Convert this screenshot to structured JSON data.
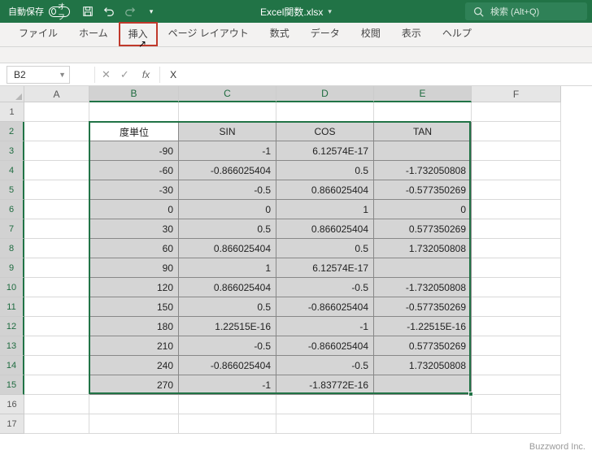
{
  "titlebar": {
    "autosave_label": "自動保存",
    "autosave_state": "オフ",
    "doc_name": "Excel関数.xlsx",
    "search_placeholder": "検索 (Alt+Q)"
  },
  "ribbon": {
    "tabs": [
      "ファイル",
      "ホーム",
      "挿入",
      "ページ レイアウト",
      "数式",
      "データ",
      "校閲",
      "表示",
      "ヘルプ"
    ],
    "highlighted_index": 2
  },
  "formula_bar": {
    "name_box": "B2",
    "formula_value": "X"
  },
  "grid": {
    "columns": [
      "A",
      "B",
      "C",
      "D",
      "E",
      "F"
    ],
    "selected_cols": [
      "B",
      "C",
      "D",
      "E"
    ],
    "row_start": 1,
    "row_end": 17,
    "selected_rows_start": 2,
    "selected_rows_end": 15,
    "headers": {
      "B": "度単位",
      "C": "SIN",
      "D": "COS",
      "E": "TAN"
    },
    "data": [
      {
        "B": "-90",
        "C": "-1",
        "D": "6.12574E-17",
        "E": ""
      },
      {
        "B": "-60",
        "C": "-0.866025404",
        "D": "0.5",
        "E": "-1.732050808"
      },
      {
        "B": "-30",
        "C": "-0.5",
        "D": "0.866025404",
        "E": "-0.577350269"
      },
      {
        "B": "0",
        "C": "0",
        "D": "1",
        "E": "0"
      },
      {
        "B": "30",
        "C": "0.5",
        "D": "0.866025404",
        "E": "0.577350269"
      },
      {
        "B": "60",
        "C": "0.866025404",
        "D": "0.5",
        "E": "1.732050808"
      },
      {
        "B": "90",
        "C": "1",
        "D": "6.12574E-17",
        "E": ""
      },
      {
        "B": "120",
        "C": "0.866025404",
        "D": "-0.5",
        "E": "-1.732050808"
      },
      {
        "B": "150",
        "C": "0.5",
        "D": "-0.866025404",
        "E": "-0.577350269"
      },
      {
        "B": "180",
        "C": "1.22515E-16",
        "D": "-1",
        "E": "-1.22515E-16"
      },
      {
        "B": "210",
        "C": "-0.5",
        "D": "-0.866025404",
        "E": "0.577350269"
      },
      {
        "B": "240",
        "C": "-0.866025404",
        "D": "-0.5",
        "E": "1.732050808"
      },
      {
        "B": "270",
        "C": "-1",
        "D": "-1.83772E-16",
        "E": ""
      }
    ]
  },
  "watermark": "Buzzword Inc."
}
